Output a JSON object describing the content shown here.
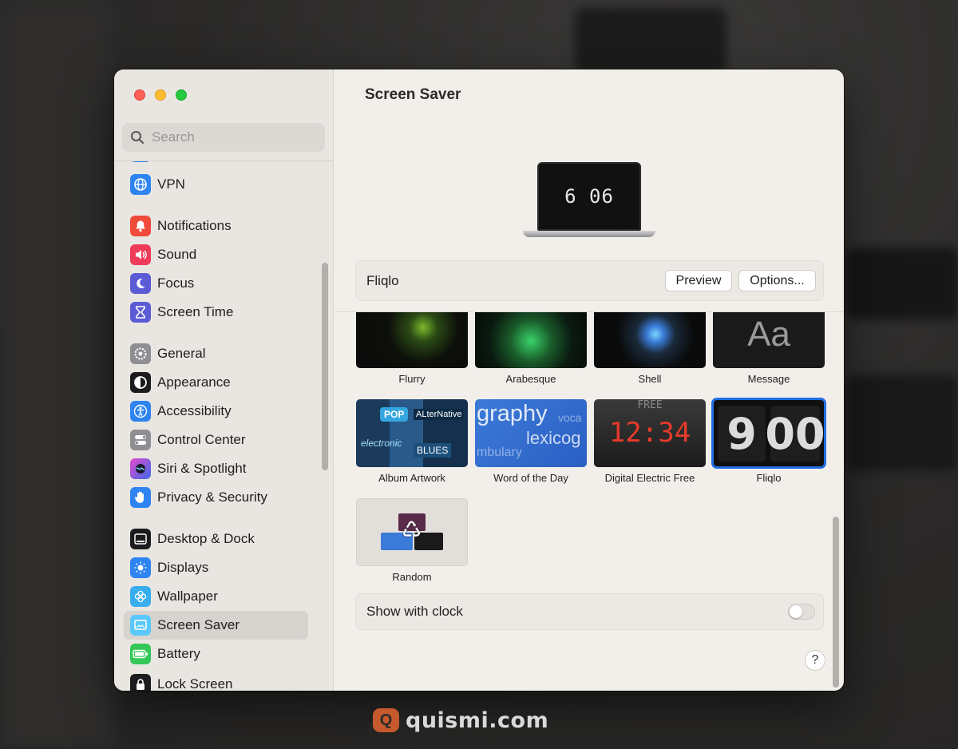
{
  "sidebar": {
    "search_placeholder": "Search",
    "items": [
      {
        "label": "VPN",
        "icon": "globe-icon",
        "color": "#2e84f0"
      },
      {
        "label": "Notifications",
        "icon": "bell-icon",
        "color": "#f04a3a"
      },
      {
        "label": "Sound",
        "icon": "speaker-icon",
        "color": "#f03a5a"
      },
      {
        "label": "Focus",
        "icon": "moon-icon",
        "color": "#5b5bd6"
      },
      {
        "label": "Screen Time",
        "icon": "hourglass-icon",
        "color": "#5b5bd6"
      },
      {
        "label": "General",
        "icon": "gear-icon",
        "color": "#8e8e93"
      },
      {
        "label": "Appearance",
        "icon": "appearance-icon",
        "color": "#1c1c1e"
      },
      {
        "label": "Accessibility",
        "icon": "accessibility-icon",
        "color": "#2e84f0"
      },
      {
        "label": "Control Center",
        "icon": "toggles-icon",
        "color": "#8e8e93"
      },
      {
        "label": "Siri & Spotlight",
        "icon": "siri-icon",
        "color": "#7b4ad8"
      },
      {
        "label": "Privacy & Security",
        "icon": "hand-icon",
        "color": "#2e84f0"
      },
      {
        "label": "Desktop & Dock",
        "icon": "dock-icon",
        "color": "#1c1c1e"
      },
      {
        "label": "Displays",
        "icon": "sun-icon",
        "color": "#2e84f0"
      },
      {
        "label": "Wallpaper",
        "icon": "flower-icon",
        "color": "#38aef0"
      },
      {
        "label": "Screen Saver",
        "icon": "screensaver-icon",
        "color": "#5ac8fa"
      },
      {
        "label": "Battery",
        "icon": "battery-icon",
        "color": "#34c759"
      },
      {
        "label": "Lock Screen",
        "icon": "lock-icon",
        "color": "#1c1c1e"
      }
    ]
  },
  "main": {
    "title": "Screen Saver",
    "preview_time": "6 06",
    "current_saver": "Fliqlo",
    "preview_button": "Preview",
    "options_button": "Options...",
    "savers": [
      {
        "label": "Flurry"
      },
      {
        "label": "Arabesque"
      },
      {
        "label": "Shell"
      },
      {
        "label": "Message",
        "thumb_text": "Aa"
      },
      {
        "label": "Album Artwork",
        "thumb_text": [
          "POP",
          "ALterNative",
          "BLUES",
          "electronic"
        ]
      },
      {
        "label": "Word of the Day",
        "thumb_text": [
          "graphy",
          "lexicog",
          "mbulary",
          "voca"
        ]
      },
      {
        "label": "Digital Electric Free",
        "thumb_text": [
          "FREE",
          "12:34"
        ]
      },
      {
        "label": "Fliqlo",
        "thumb_text": [
          "9",
          "00"
        ],
        "selected": true
      },
      {
        "label": "Random"
      }
    ],
    "show_with_clock_label": "Show with clock",
    "show_with_clock_on": false,
    "help_label": "?"
  },
  "watermark": {
    "text": "quismi.com"
  },
  "colors": {
    "accent": "#1f6fe5",
    "close": "#fe5f57",
    "minimize": "#febc2e",
    "maximize": "#28c840"
  }
}
